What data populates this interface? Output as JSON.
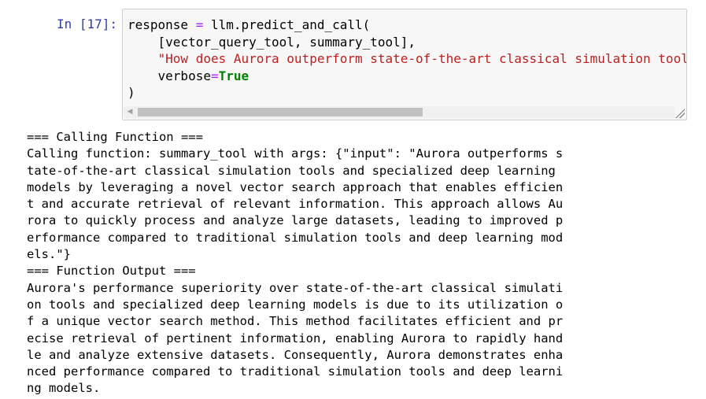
{
  "cell": {
    "prompt": "In [17]:",
    "code": {
      "line1_var": "response ",
      "line1_op": "=",
      "line1_rest": " llm.predict_and_call(",
      "line2": "    [vector_query_tool, summary_tool],",
      "line3_indent": "    ",
      "line3_string": "\"How does Aurora outperform state-of-the-art classical simulation tool",
      "line4_indent": "    ",
      "line4_param": "verbose",
      "line4_op": "=",
      "line4_value": "True",
      "line5": ")"
    },
    "scroll_left_glyph": "◀"
  },
  "output": {
    "lines": [
      "=== Calling Function ===",
      "Calling function: summary_tool with args: {\"input\": \"Aurora outperforms s",
      "tate-of-the-art classical simulation tools and specialized deep learning ",
      "models by leveraging a novel vector search approach that enables efficien",
      "t and accurate retrieval of relevant information. This approach allows Au",
      "rora to quickly process and analyze large datasets, leading to improved p",
      "erformance compared to traditional simulation tools and deep learning mod",
      "els.\"}",
      "=== Function Output ===",
      "Aurora's performance superiority over state-of-the-art classical simulati",
      "on tools and specialized deep learning models is due to its utilization o",
      "f a unique vector search method. This method facilitates efficient and pr",
      "ecise retrieval of pertinent information, enabling Aurora to rapidly hand",
      "le and analyze extensive datasets. Consequently, Aurora demonstrates enha",
      "nced performance compared to traditional simulation tools and deep learni",
      "ng models."
    ]
  },
  "colors": {
    "prompt": "#303f9f",
    "operator": "#aa22ff",
    "string": "#ba2121",
    "keyword": "#008000",
    "cell_bg": "#f7f7f7"
  }
}
